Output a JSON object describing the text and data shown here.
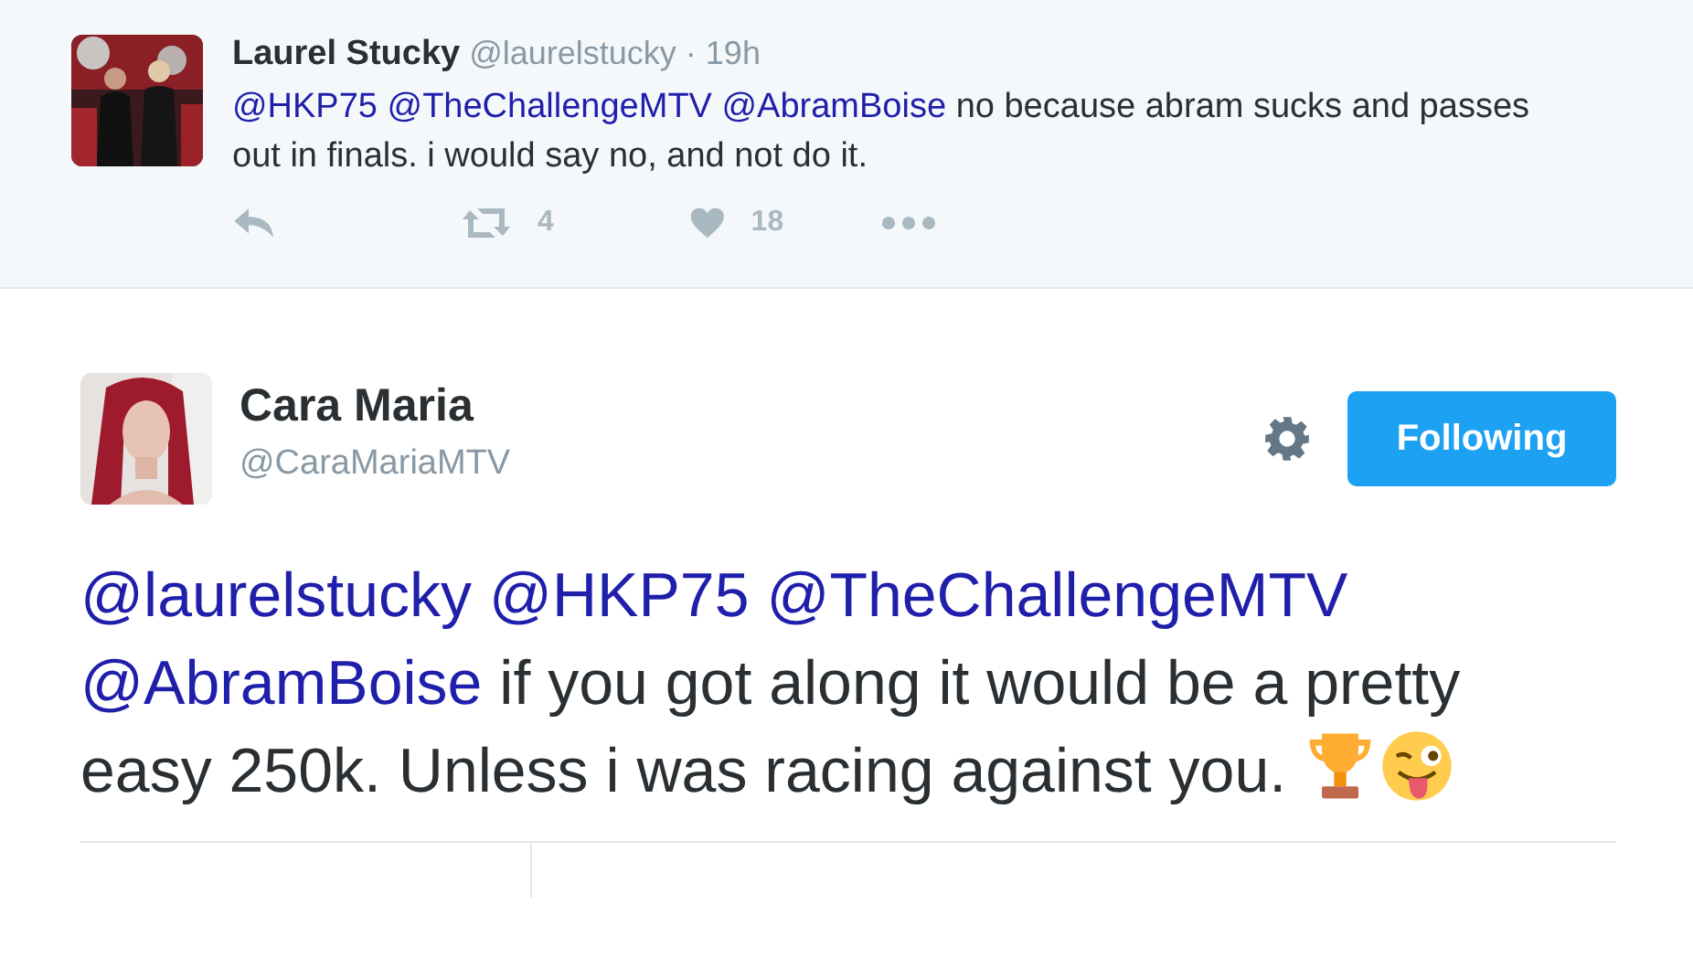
{
  "reply_tweet": {
    "author": {
      "name": "Laurel Stucky",
      "handle": "@laurelstucky"
    },
    "time": "· 19h",
    "text": [
      {
        "kind": "mention",
        "text": "@HKP75"
      },
      {
        "kind": "mention",
        "text": "@TheChallengeMTV"
      },
      {
        "kind": "mention",
        "text": "@AbramBoise"
      },
      {
        "kind": "plain",
        "text": " no because abram sucks and passes out in finals. i would say no, and not do it."
      }
    ],
    "actions": [
      {
        "kind": "reply"
      },
      {
        "kind": "retweet",
        "count": "4"
      },
      {
        "kind": "like",
        "count": "18"
      },
      {
        "kind": "more"
      }
    ]
  },
  "main_tweet": {
    "author": {
      "name": "Cara Maria",
      "handle": "@CaraMariaMTV"
    },
    "follow_button": {
      "label": "Following"
    },
    "text": [
      {
        "kind": "mention",
        "text": "@laurelstucky"
      },
      {
        "kind": "mention",
        "text": "@HKP75"
      },
      {
        "kind": "mention",
        "text": "@TheChallengeMTV"
      },
      {
        "kind": "mention",
        "text": "@AbramBoise"
      },
      {
        "kind": "plain",
        "text": " if you got along it would be a pretty easy 250k. Unless i was racing against you. "
      },
      {
        "kind": "emoji-trophy"
      },
      {
        "kind": "emoji-wink"
      }
    ]
  }
}
